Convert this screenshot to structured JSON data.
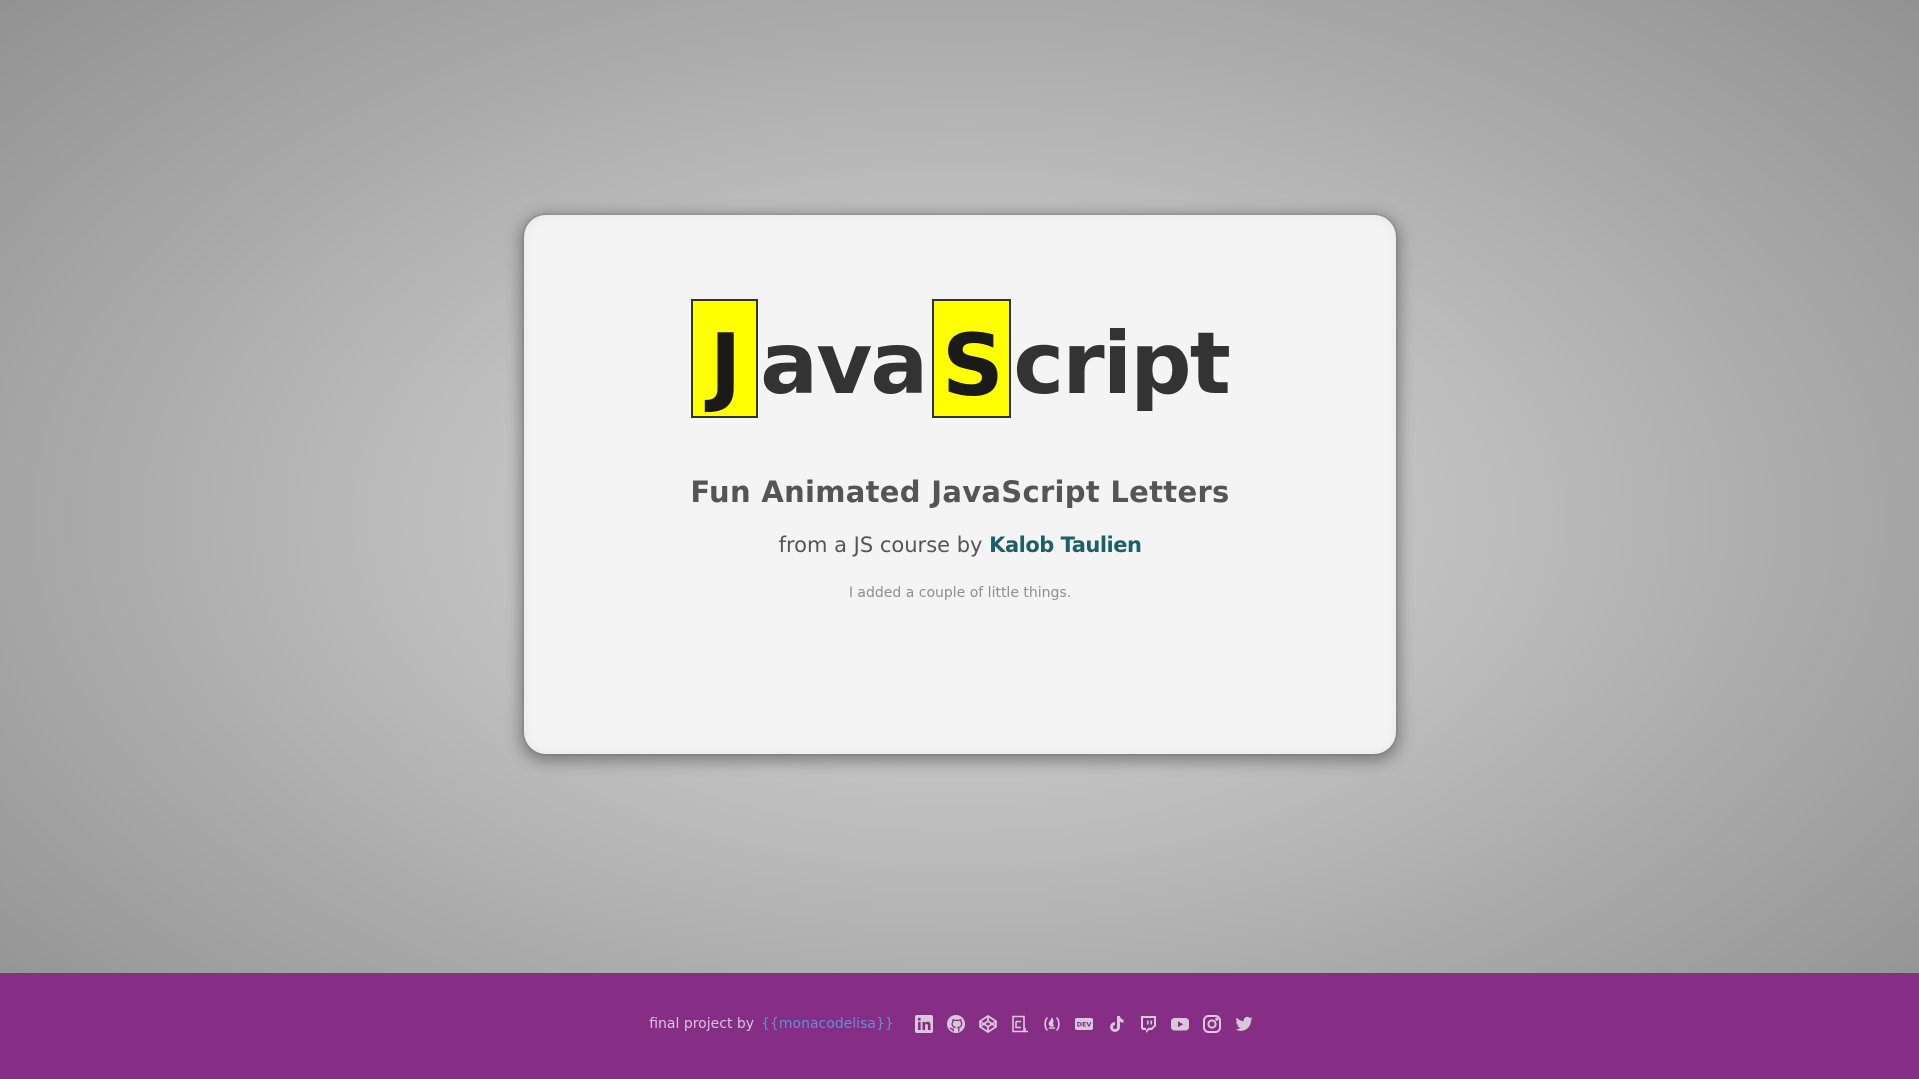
{
  "logo": {
    "boxed_1": "J",
    "plain_1": "ava",
    "boxed_2": "S",
    "plain_2": "cript"
  },
  "card": {
    "headline": "Fun Animated JavaScript Letters",
    "byline_prefix": "from a JS course by",
    "author": "Kalob Taulien",
    "note": "I added a couple of little things."
  },
  "footer": {
    "credit": "final project by",
    "handle": "{{monacodelisa}}",
    "icons": [
      "linkedin-icon",
      "github-icon",
      "codepen-icon",
      "codesandbox-icon",
      "freecodecamp-icon",
      "dev-icon",
      "tiktok-icon",
      "twitch-icon",
      "youtube-icon",
      "instagram-icon",
      "twitter-icon"
    ],
    "dev_label": "DEV"
  },
  "colors": {
    "accent_yellow": "#ffff00",
    "footer_bg": "#862d86",
    "author_link": "#1d5f66",
    "handle_link": "#5f8fd8"
  }
}
